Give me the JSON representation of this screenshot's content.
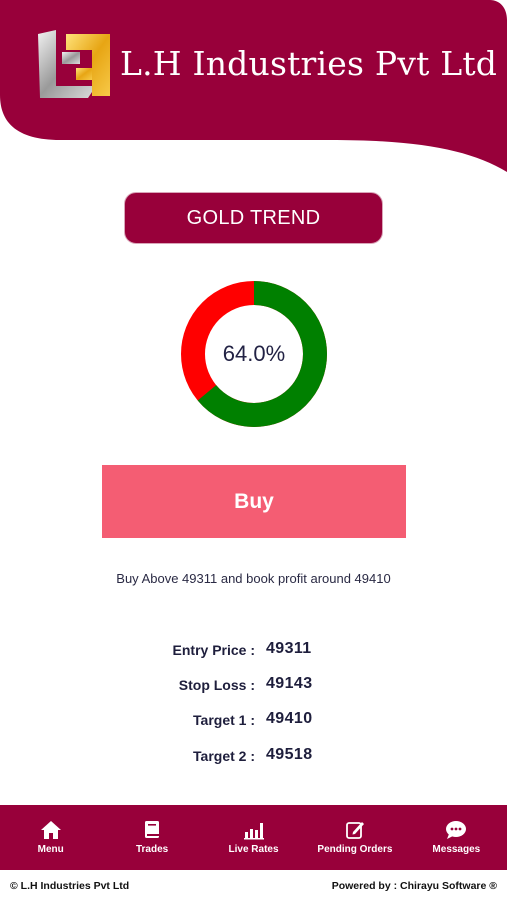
{
  "header": {
    "brand_name": "L.H Industries Pvt Ltd",
    "logo_icon": "lh-logo-icon",
    "color": "#98003a"
  },
  "trend": {
    "title": "GOLD TREND",
    "percent_label": "64.0%",
    "percent_value": 64.0,
    "colors": {
      "positive": "#008000",
      "negative": "#ff0000"
    }
  },
  "signal": {
    "action_label": "Buy",
    "advice": "Buy Above 49311 and book profit around 49410",
    "color": "#f45d73"
  },
  "details": [
    {
      "label": "Entry Price :",
      "value": "49311"
    },
    {
      "label": "Stop Loss :",
      "value": "49143"
    },
    {
      "label": "Target 1 :",
      "value": "49410"
    },
    {
      "label": "Target 2 :",
      "value": "49518"
    }
  ],
  "nav": [
    {
      "label": "Menu",
      "icon": "home-icon"
    },
    {
      "label": "Trades",
      "icon": "book-icon"
    },
    {
      "label": "Live Rates",
      "icon": "bar-chart-icon"
    },
    {
      "label": "Pending Orders",
      "icon": "edit-icon"
    },
    {
      "label": "Messages",
      "icon": "chat-icon"
    }
  ],
  "footer": {
    "copyright": "© L.H Industries Pvt Ltd",
    "powered_by": "Powered by : Chirayu Software ®"
  }
}
